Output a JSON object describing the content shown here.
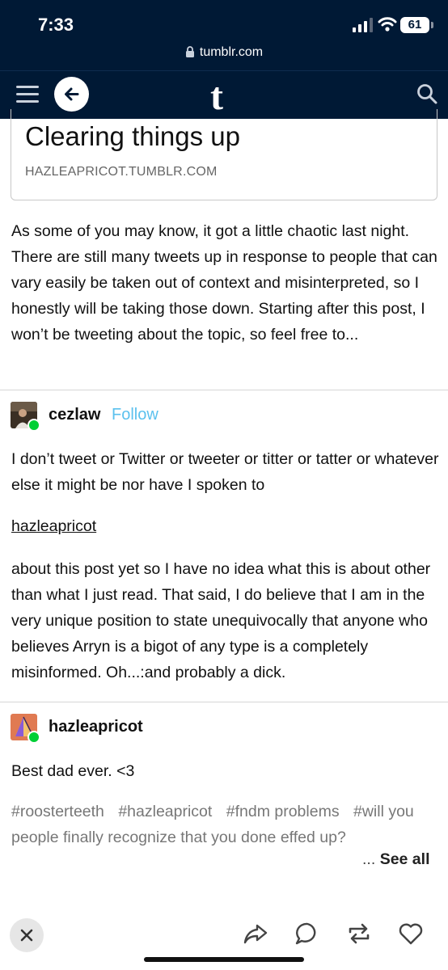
{
  "status": {
    "time": "7:33",
    "battery": "61"
  },
  "browser": {
    "url": "tumblr.com"
  },
  "nav": {
    "logo": "t"
  },
  "link_card": {
    "title": "Clearing things up",
    "domain": "HAZLEAPRICOT.TUMBLR.COM"
  },
  "post": {
    "text": "As some of you may know, it got a little chaotic last night. There are still many tweets up in response to people that can vary easily be taken out of context and misinterpreted, so I honestly will be taking those down. Starting after this post, I won’t be tweeting about the topic, so feel free to..."
  },
  "reblog1": {
    "username": "cezlaw",
    "follow_label": "Follow",
    "text1": "I don’t tweet or Twitter or tweeter or titter or tatter or whatever else it might be nor have I spoken to",
    "mention": "hazleapricot",
    "text2": "about this post yet so I have no idea what this is about other than what I just read. That said, I do believe that I am in the very unique position to state unequivocally that anyone who believes Arryn is a bigot of any type is a completely misinformed. Oh...:and probably a dick."
  },
  "reblog2": {
    "username": "hazleapricot",
    "text": "Best dad ever. <3",
    "tags": [
      "#roosterteeth",
      "#hazleapricot",
      "#fndm problems",
      "#will you people finally recognize that you done effed up?"
    ],
    "see_all_prefix": "...",
    "see_all": "See all"
  },
  "colors": {
    "topbar": "#001935",
    "follow": "#5bc1ee",
    "reblog_badge": "#00cf35"
  },
  "icons": [
    "lock-icon",
    "hamburger-icon",
    "back-arrow-icon",
    "tumblr-logo",
    "search-icon",
    "close-icon",
    "share-icon",
    "reply-icon",
    "reblog-icon",
    "heart-icon"
  ]
}
